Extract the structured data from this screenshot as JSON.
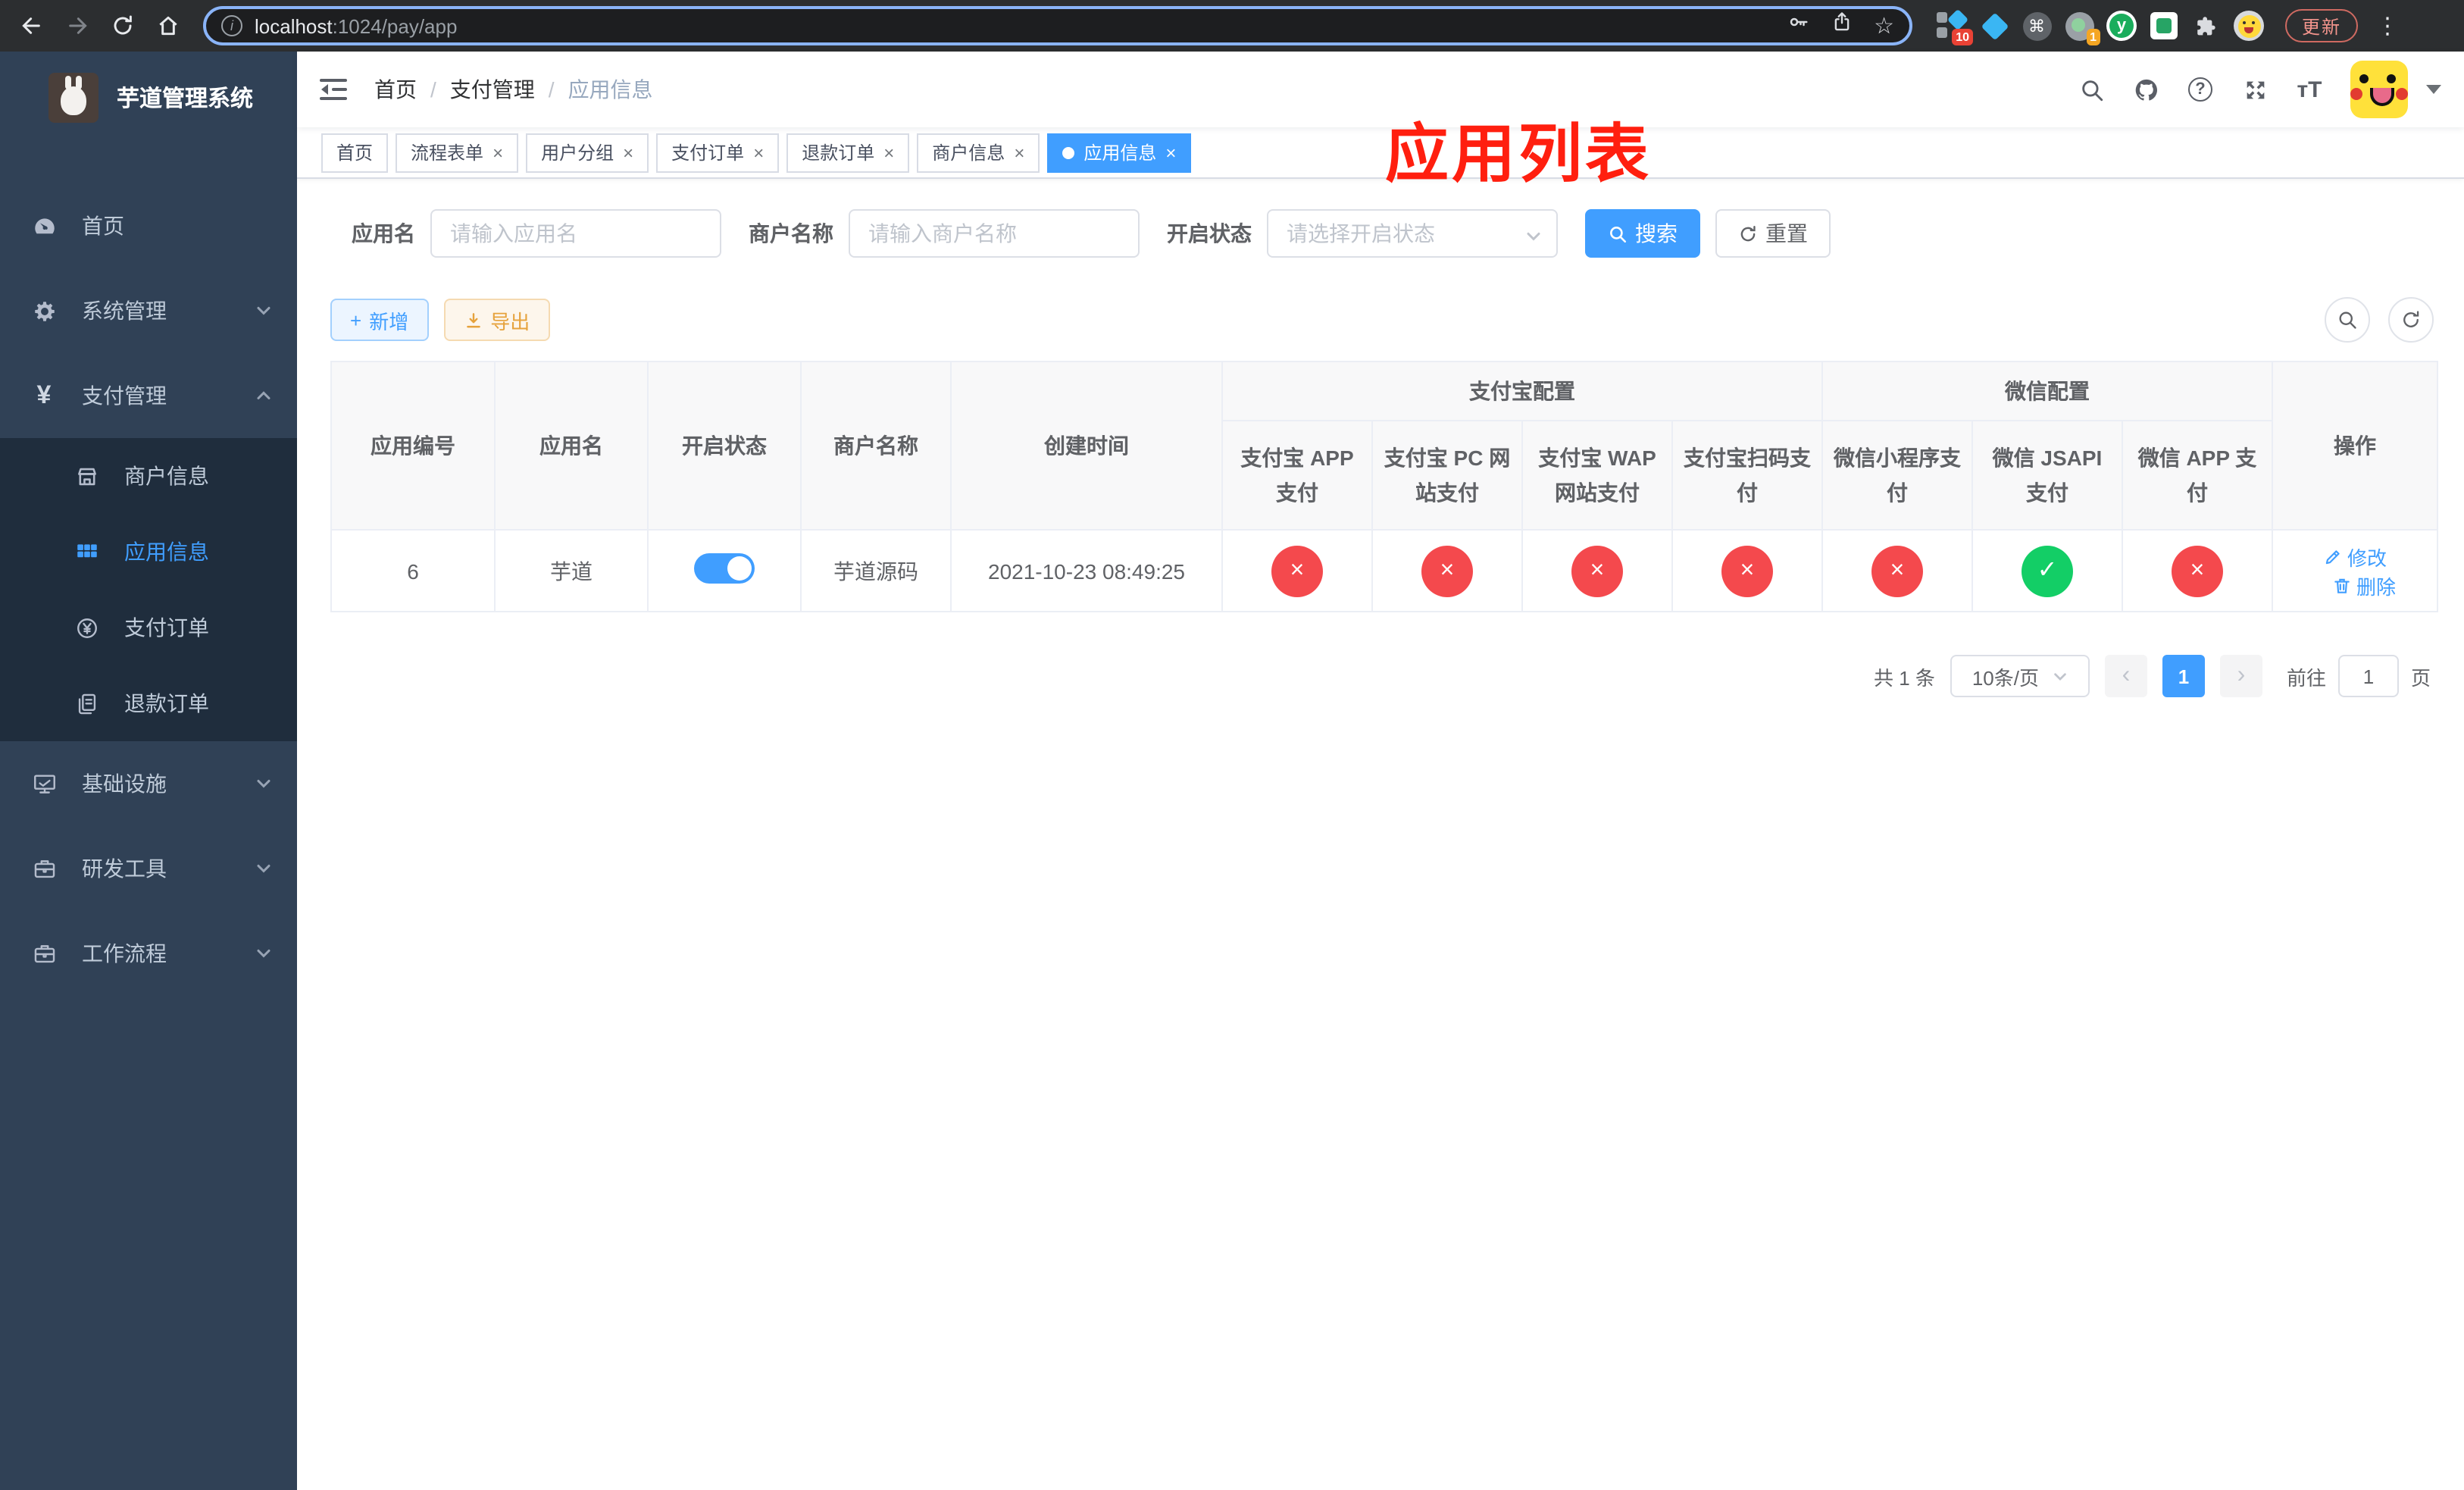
{
  "browser": {
    "url": {
      "host": "localhost",
      "rest": ":1024/pay/app"
    },
    "update_label": "更新",
    "ext": {
      "badge10": "10",
      "badge1": "1",
      "y": "y"
    }
  },
  "icons": {
    "close": "×",
    "check": "✓",
    "yen": "¥",
    "star": "☆",
    "cmd": "⌘",
    "dots": "⋮",
    "info": "i",
    "question": "?",
    "prev": "‹",
    "next": "›",
    "font_size": "тT",
    "plus": "+"
  },
  "annotation": {
    "title": "应用列表",
    "color": "#ff1f0f"
  },
  "sidebar": {
    "title": "芋道管理系统",
    "menu": [
      {
        "label": "首页"
      },
      {
        "label": "系统管理"
      },
      {
        "label": "支付管理"
      },
      {
        "label": "商户信息"
      },
      {
        "label": "应用信息"
      },
      {
        "label": "支付订单"
      },
      {
        "label": "退款订单"
      },
      {
        "label": "基础设施"
      },
      {
        "label": "研发工具"
      },
      {
        "label": "工作流程"
      }
    ]
  },
  "navbar": {
    "breadcrumb": {
      "home": "首页",
      "sep": "/",
      "section": "支付管理",
      "current": "应用信息"
    }
  },
  "tabs": [
    {
      "label": "首页"
    },
    {
      "label": "流程表单"
    },
    {
      "label": "用户分组"
    },
    {
      "label": "支付订单"
    },
    {
      "label": "退款订单"
    },
    {
      "label": "商户信息"
    },
    {
      "label": "应用信息"
    }
  ],
  "filters": {
    "app_name_label": "应用名",
    "app_name_placeholder": "请输入应用名",
    "merchant_label": "商户名称",
    "merchant_placeholder": "请输入商户名称",
    "status_label": "开启状态",
    "status_placeholder": "请选择开启状态",
    "search_label": "搜索",
    "reset_label": "重置"
  },
  "toolbar": {
    "add": "新增",
    "export": "导出"
  },
  "table": {
    "headers": {
      "app_id": "应用编号",
      "app_name": "应用名",
      "status": "开启状态",
      "merchant": "商户名称",
      "created": "创建时间",
      "alipay_group": "支付宝配置",
      "wechat_group": "微信配置",
      "actions": "操作",
      "alipay_app": "支付宝 APP 支付",
      "alipay_pc": "支付宝 PC 网站支付",
      "alipay_wap": "支付宝 WAP 网站支付",
      "alipay_qr": "支付宝扫码支付",
      "wx_lite": "微信小程序支付",
      "wx_jsapi": "微信 JSAPI 支付",
      "wx_app": "微信 APP 支付"
    },
    "row": {
      "id": "6",
      "name": "芋道",
      "enabled": true,
      "merchant": "芋道源码",
      "created": "2021-10-23 08:49:25",
      "statuses": [
        "×",
        "×",
        "×",
        "×",
        "×",
        "✓",
        "×"
      ],
      "edit": "修改",
      "delete": "删除"
    }
  },
  "pagination": {
    "total": "共 1 条",
    "size": "10条/页",
    "page": "1",
    "goto": "前往",
    "goto_value": "1",
    "unit": "页"
  },
  "colors": {
    "accent": "#409eff",
    "success": "#13ce66",
    "danger": "#f4494d",
    "sidebar_bg": "#304156",
    "submenu_bg": "#1f2d3d",
    "annotation": "#ff1f0f"
  }
}
